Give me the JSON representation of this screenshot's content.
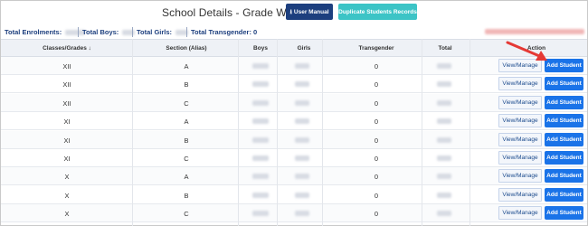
{
  "header": {
    "title": "School Details - Grade Wise",
    "user_manual_label": "User Manual",
    "duplicate_label": "Duplicate Students Records"
  },
  "summary": {
    "total_enrolments_label": "Total Enrolments:",
    "total_boys_label": "Total Boys:",
    "total_girls_label": "Total Girls:",
    "total_transgender_label": "Total Transgender: 0"
  },
  "table": {
    "columns": [
      "Classes/Grades",
      "Section (Alias)",
      "Boys",
      "Girls",
      "Transgender",
      "Total",
      "Action"
    ],
    "sort_icon": "↓",
    "view_label": "View/Manage",
    "add_label": "Add Student",
    "rows": [
      {
        "grade": "XII",
        "section": "A",
        "transgender": "0"
      },
      {
        "grade": "XII",
        "section": "B",
        "transgender": "0"
      },
      {
        "grade": "XII",
        "section": "C",
        "transgender": "0"
      },
      {
        "grade": "XI",
        "section": "A",
        "transgender": "0"
      },
      {
        "grade": "XI",
        "section": "B",
        "transgender": "0"
      },
      {
        "grade": "XI",
        "section": "C",
        "transgender": "0"
      },
      {
        "grade": "X",
        "section": "A",
        "transgender": "0"
      },
      {
        "grade": "X",
        "section": "B",
        "transgender": "0"
      },
      {
        "grade": "X",
        "section": "C",
        "transgender": "0"
      }
    ]
  },
  "colors": {
    "accent_navy": "#1d3f7e",
    "accent_teal": "#3cc4c6",
    "add_button_blue": "#1a73e8",
    "annotation_arrow": "#e53935"
  },
  "icons": {
    "download": "download-icon",
    "sort": "sort-down-icon",
    "annotation": "annotation-arrow-icon"
  }
}
